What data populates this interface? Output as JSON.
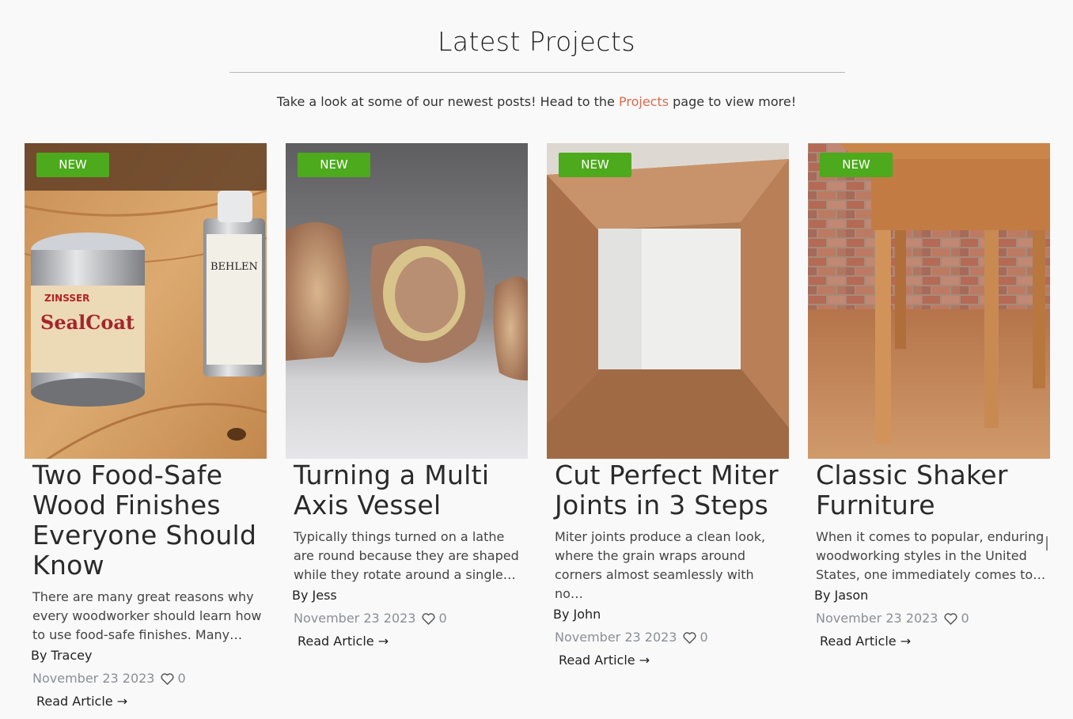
{
  "section": {
    "title": "Latest Projects",
    "intro_before": "Take a look at some of our newest posts! Head to the ",
    "intro_link": "Projects",
    "intro_after": " page to view more!"
  },
  "colors": {
    "badge": "#4caa1c",
    "link": "#e0694c",
    "meta": "#8a8f95"
  },
  "cards": [
    {
      "badge": "NEW",
      "title": "Two Food-Safe Wood Finishes Everyone Should Know",
      "excerpt": "There are many great reasons why every woodworker should learn how to use food-safe finishes. Many…",
      "author": "By Tracey",
      "date": "November 23 2023",
      "likes": "0",
      "read_more": "Read Article →",
      "image_alt": "Zinsser SealCoat and Behlen Tung Oil cans on a wooden workbench",
      "image_label_1": "ZINSSER",
      "image_label_2": "SealCoat",
      "image_label_3": "BEHLEN"
    },
    {
      "badge": "NEW",
      "title": "Turning a Multi Axis Vessel",
      "excerpt": "Typically things turned on a lathe are round because they are shaped while they rotate around a single…",
      "author": "By Jess",
      "date": "November 23 2023",
      "likes": "0",
      "read_more": "Read Article →",
      "image_alt": "Turned burl wood vessels on a grey background"
    },
    {
      "badge": "NEW",
      "title": "Cut Perfect Miter Joints in 3 Steps",
      "excerpt": "Miter joints produce a clean look, where the grain wraps around corners almost seamlessly with no…",
      "author": "By John",
      "date": "November 23 2023",
      "likes": "0",
      "read_more": "Read Article →",
      "image_alt": "Mitered wooden picture frame"
    },
    {
      "badge": "NEW",
      "title": "Classic Shaker Furniture",
      "excerpt": "When it comes to popular, enduring woodworking styles in the United States, one immediately comes to…",
      "author": "By Jason",
      "date": "November 23 2023",
      "likes": "0",
      "read_more": "Read Article →",
      "image_alt": "Cherry Shaker side table in front of a brick wall"
    }
  ]
}
